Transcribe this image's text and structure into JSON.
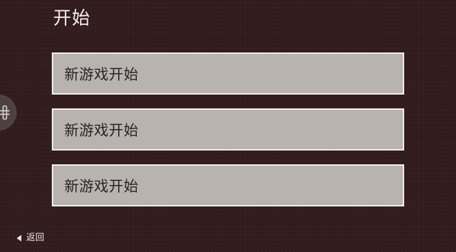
{
  "header": {
    "title": "开始"
  },
  "menu": {
    "items": [
      {
        "label": "新游戏开始"
      },
      {
        "label": "新游戏开始"
      },
      {
        "label": "新游戏开始"
      }
    ]
  },
  "footer": {
    "back_label": "返回"
  },
  "icons": {
    "side_handle": "menu-handle-icon",
    "back": "back-arrow-icon"
  },
  "colors": {
    "background": "#321b1d",
    "button_fill": "#b8b3ae",
    "button_border": "#f2efed",
    "button_text": "#2a2323",
    "title_text": "#f3f0ef"
  }
}
